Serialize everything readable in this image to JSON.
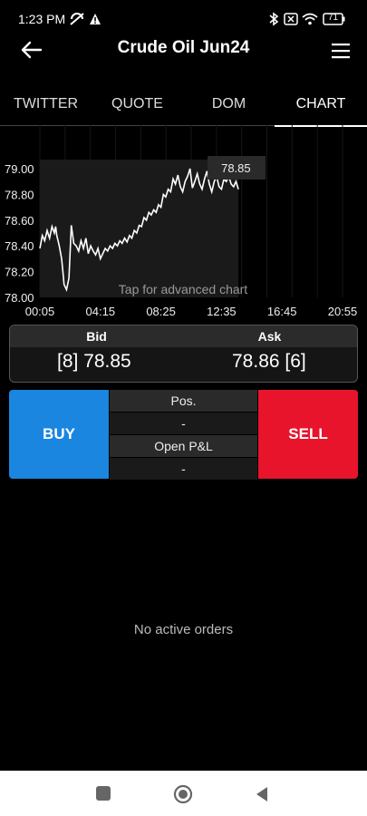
{
  "status": {
    "time": "1:23 PM",
    "battery": "71",
    "icons": [
      "mute-icon",
      "warning-icon",
      "bluetooth-icon",
      "sim-off-icon",
      "wifi-icon",
      "battery-icon"
    ]
  },
  "header": {
    "title": "Crude Oil Jun24",
    "back_icon": "back-arrow-icon",
    "menu_icon": "hamburger-menu-icon"
  },
  "tabs": [
    {
      "label": "TWITTER",
      "active": false
    },
    {
      "label": "QUOTE",
      "active": false
    },
    {
      "label": "DOM",
      "active": false
    },
    {
      "label": "CHART",
      "active": true
    }
  ],
  "chart_data": {
    "type": "line",
    "title": "",
    "hint": "Tap for advanced chart",
    "current_price_label": "78.85",
    "y_ticks": [
      "79.00",
      "78.80",
      "78.60",
      "78.40",
      "78.20",
      "78.00"
    ],
    "x_ticks": [
      "00:05",
      "04:15",
      "08:25",
      "12:35",
      "16:45",
      "20:55"
    ],
    "ylim": [
      78.0,
      79.0
    ],
    "x_minutes_range": [
      5,
      1255
    ],
    "series": [
      {
        "x": [
          5,
          15,
          25,
          35,
          45,
          55,
          65,
          70,
          75,
          85,
          95,
          100,
          105,
          115,
          125,
          135,
          145,
          155,
          165,
          175,
          185,
          195,
          205,
          215,
          225,
          235,
          245,
          255,
          265,
          275,
          285,
          295,
          305,
          315,
          325,
          335,
          345,
          355,
          365,
          375,
          385,
          395,
          405,
          415,
          425,
          435,
          445,
          455,
          465,
          475,
          485,
          495,
          505,
          515,
          525,
          535,
          545,
          555,
          565,
          575,
          585,
          595,
          605,
          615,
          625,
          635,
          645,
          655,
          665,
          675,
          685,
          695,
          705,
          715,
          725,
          735,
          745,
          755,
          765,
          775,
          785,
          795,
          805,
          815,
          825
        ],
        "values": [
          78.38,
          78.48,
          78.44,
          78.52,
          78.46,
          78.55,
          78.5,
          78.55,
          78.48,
          78.4,
          78.3,
          78.2,
          78.1,
          78.06,
          78.15,
          78.56,
          78.42,
          78.4,
          78.36,
          78.44,
          78.38,
          78.46,
          78.34,
          78.4,
          78.36,
          78.33,
          78.38,
          78.3,
          78.34,
          78.38,
          78.36,
          78.4,
          78.38,
          78.42,
          78.4,
          78.44,
          78.42,
          78.46,
          78.43,
          78.48,
          78.46,
          78.52,
          78.5,
          78.56,
          78.55,
          78.62,
          78.6,
          78.66,
          78.64,
          78.68,
          78.66,
          78.72,
          78.7,
          78.8,
          78.78,
          78.84,
          78.82,
          78.92,
          78.88,
          78.95,
          78.86,
          78.82,
          78.9,
          78.94,
          79.0,
          78.85,
          78.9,
          78.96,
          78.88,
          78.84,
          78.92,
          78.98,
          78.88,
          78.82,
          78.9,
          78.94,
          78.86,
          78.84,
          78.92,
          78.9,
          78.94,
          78.88,
          78.86,
          78.9,
          78.84
        ]
      }
    ]
  },
  "quote": {
    "bid_label": "Bid",
    "ask_label": "Ask",
    "bid_value": "[8] 78.85",
    "ask_value": "78.86 [6]"
  },
  "trade": {
    "buy_label": "BUY",
    "sell_label": "SELL",
    "pos_label": "Pos.",
    "pos_value": "-",
    "pnl_label": "Open P&L",
    "pnl_value": "-"
  },
  "orders": {
    "empty_text": "No active orders"
  },
  "navbar": {
    "icons": [
      "recents-square-icon",
      "home-circle-icon",
      "back-triangle-icon"
    ]
  }
}
